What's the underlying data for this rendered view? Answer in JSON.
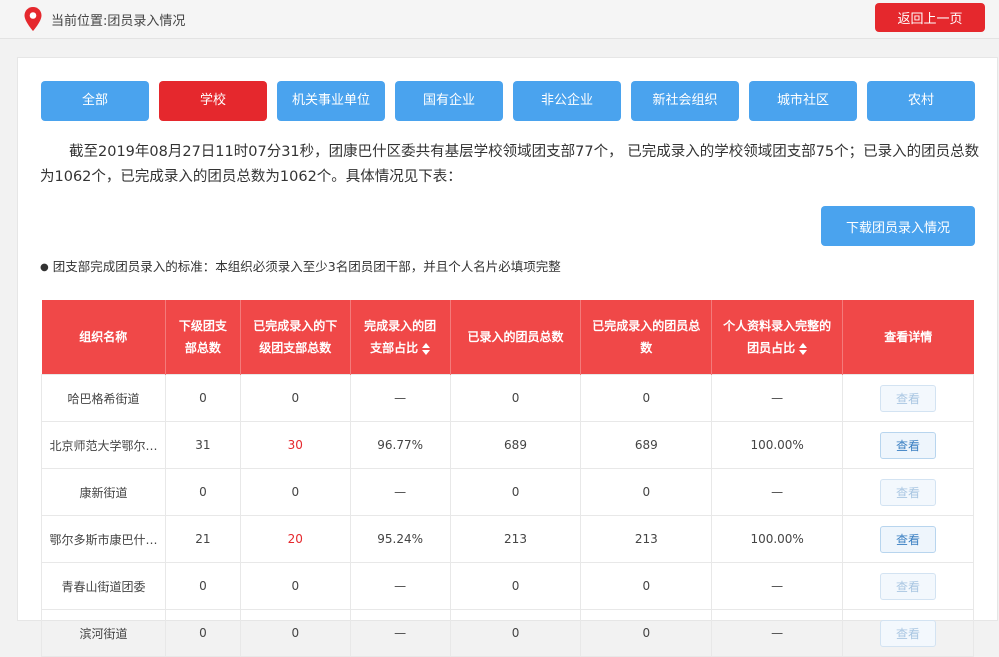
{
  "breadcrumb": {
    "text": "当前位置:团员录入情况"
  },
  "back_button": "返回上一页",
  "tabs": [
    {
      "label": "全部",
      "active": false
    },
    {
      "label": "学校",
      "active": true
    },
    {
      "label": "机关事业单位",
      "active": false
    },
    {
      "label": "国有企业",
      "active": false
    },
    {
      "label": "非公企业",
      "active": false
    },
    {
      "label": "新社会组织",
      "active": false
    },
    {
      "label": "城市社区",
      "active": false
    },
    {
      "label": "农村",
      "active": false
    }
  ],
  "summary": "截至2019年08月27日11时07分31秒，团康巴什区委共有基层学校领域团支部77个， 已完成录入的学校领域团支部75个；已录入的团员总数为1062个，已完成录入的团员总数为1062个。具体情况见下表：",
  "download_button": "下载团员录入情况",
  "note": "团支部完成团员录入的标准：本组织必须录入至少3名团员团干部，并且个人名片必填项完整",
  "table": {
    "headers": [
      "组织名称",
      "下级团支部总数",
      "已完成录入的下级团支部总数",
      "完成录入的团支部占比",
      "已录入的团员总数",
      "已完成录入的团员总数",
      "个人资料录入完整的团员占比",
      "查看详情"
    ],
    "rows": [
      {
        "name": "哈巴格希街道",
        "sub": "0",
        "done": "0",
        "ratio": "—",
        "members": "0",
        "done_members": "0",
        "complete": "—",
        "view": "查看",
        "enabled": false
      },
      {
        "name": "北京师范大学鄂尔…",
        "sub": "31",
        "done": "30",
        "ratio": "96.77%",
        "members": "689",
        "done_members": "689",
        "complete": "100.00%",
        "view": "查看",
        "enabled": true
      },
      {
        "name": "康新街道",
        "sub": "0",
        "done": "0",
        "ratio": "—",
        "members": "0",
        "done_members": "0",
        "complete": "—",
        "view": "查看",
        "enabled": false
      },
      {
        "name": "鄂尔多斯市康巴什…",
        "sub": "21",
        "done": "20",
        "ratio": "95.24%",
        "members": "213",
        "done_members": "213",
        "complete": "100.00%",
        "view": "查看",
        "enabled": true
      },
      {
        "name": "青春山街道团委",
        "sub": "0",
        "done": "0",
        "ratio": "—",
        "members": "0",
        "done_members": "0",
        "complete": "—",
        "view": "查看",
        "enabled": false
      },
      {
        "name": "滨河街道",
        "sub": "0",
        "done": "0",
        "ratio": "—",
        "members": "0",
        "done_members": "0",
        "complete": "—",
        "view": "查看",
        "enabled": false
      }
    ]
  },
  "colors": {
    "primary": "#4aa3ee",
    "accent": "#e5282d",
    "header": "#f04848"
  }
}
